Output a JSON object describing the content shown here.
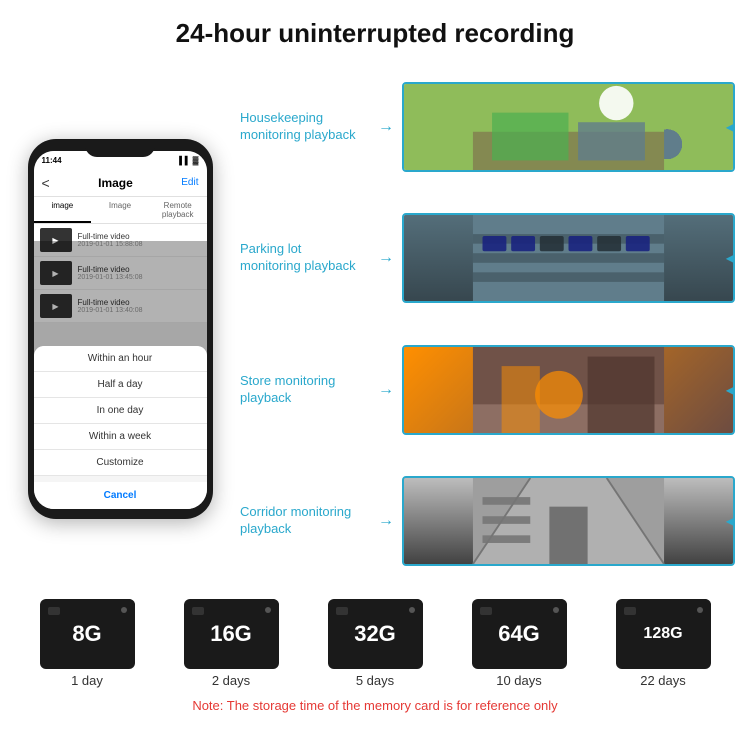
{
  "header": {
    "title": "24-hour uninterrupted recording"
  },
  "phone": {
    "status_time": "11:44",
    "app_title": "Image",
    "back_label": "<",
    "edit_label": "Edit",
    "tabs": [
      "image",
      "Image",
      "Remote playback"
    ],
    "videos": [
      {
        "label": "Full-time video",
        "date": "2019-01-01 15:88:08"
      },
      {
        "label": "Full-time video",
        "date": "2019-01-01 13:45:08"
      },
      {
        "label": "Full-time video",
        "date": "2019-01-01 13:40:08"
      }
    ],
    "dropdown_items": [
      "Within an hour",
      "Half a day",
      "In one day",
      "Within a week",
      "Customize"
    ],
    "cancel_label": "Cancel"
  },
  "monitoring": [
    {
      "label": "Housekeeping\nmonitoring playback",
      "img_class": "img-housekeeping"
    },
    {
      "label": "Parking lot\nmonitoring playback",
      "img_class": "img-parking"
    },
    {
      "label": "Store monitoring\nplayback",
      "img_class": "img-store"
    },
    {
      "label": "Corridor monitoring\nplayback",
      "img_class": "img-corridor"
    }
  ],
  "sd_cards": [
    {
      "capacity": "8G",
      "days": "1 day"
    },
    {
      "capacity": "16G",
      "days": "2 days"
    },
    {
      "capacity": "32G",
      "days": "5 days"
    },
    {
      "capacity": "64G",
      "days": "10 days"
    },
    {
      "capacity": "128G",
      "days": "22 days"
    }
  ],
  "note": "Note: The storage time of the memory card is for reference only"
}
